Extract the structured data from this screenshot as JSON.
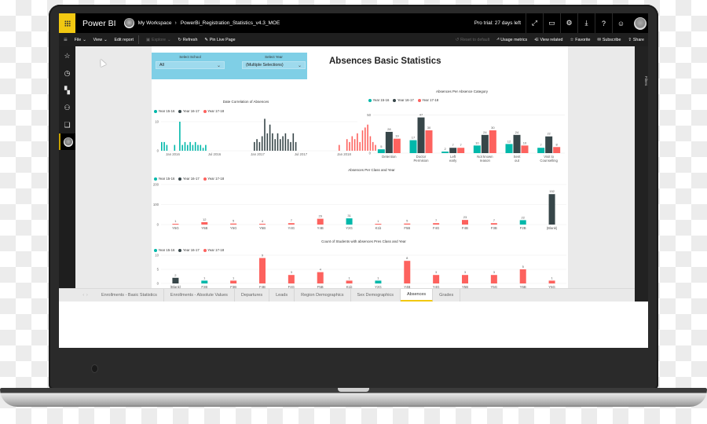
{
  "app": {
    "brand": "Power BI",
    "breadcrumb": [
      "My Workspace",
      "PowerBi_Registration_Statistics_v4.3_MOE"
    ],
    "trial_text": "Pro trial: 27 days left",
    "topbar_icons": [
      "expand-icon",
      "feedback-icon",
      "gear-icon",
      "download-icon",
      "help-icon",
      "smiley-icon"
    ]
  },
  "actionbar": {
    "file": "File",
    "view": "View",
    "edit_report": "Edit report",
    "explore": "Explore",
    "refresh": "Refresh",
    "pin_live_page": "Pin Live Page",
    "reset_to_default": "Reset to default",
    "usage_metrics": "Usage metrics",
    "view_related": "View related",
    "favorite": "Favorite",
    "subscribe": "Subscribe",
    "share": "Share"
  },
  "rightpane": {
    "label": "Filters"
  },
  "slicers": [
    {
      "label": "Select School",
      "value": "All"
    },
    {
      "label": "Select Year",
      "value": "(Multiple Selections)"
    }
  ],
  "report": {
    "title": "Absences Basic Statistics"
  },
  "legend": [
    "Year 15-16",
    "Year 16-17",
    "Year 17-18"
  ],
  "colors": {
    "y1516": "#01b8aa",
    "y1617": "#374649",
    "y1718": "#fd625e",
    "accent": "#f2c811"
  },
  "tabs": [
    {
      "label": "Enrollments - Basic Statistics",
      "active": false
    },
    {
      "label": "Enrollments - Absolute Values",
      "active": false
    },
    {
      "label": "Departures",
      "active": false
    },
    {
      "label": "Leads",
      "active": false
    },
    {
      "label": "Region Demographics",
      "active": false
    },
    {
      "label": "Sex Demographics",
      "active": false
    },
    {
      "label": "Absences",
      "active": true
    },
    {
      "label": "Grades",
      "active": false
    }
  ],
  "chart_data": [
    {
      "id": "date-correlation",
      "type": "bar",
      "title": "Date Correlation of Absences",
      "x_ticks": [
        "Jan 2016",
        "Jul 2016",
        "Jan 2017",
        "Jul 2017",
        "Jan 2018"
      ],
      "ylim": [
        0,
        10
      ],
      "y_ticks": [
        0,
        10
      ],
      "series": [
        {
          "name": "Year 15-16",
          "values": [
            3,
            3,
            2,
            0,
            0,
            2,
            0,
            10,
            2,
            3,
            2,
            3,
            2,
            3,
            2,
            2,
            1,
            2
          ]
        },
        {
          "name": "Year 16-17",
          "values": [
            3,
            4,
            3,
            5,
            11,
            6,
            9,
            6,
            4,
            6,
            4,
            5,
            6,
            4,
            3,
            6,
            3
          ]
        },
        {
          "name": "Year 17-18",
          "values": [
            2,
            0,
            0,
            4,
            3,
            5,
            4,
            6,
            3,
            7,
            8,
            9,
            5,
            3,
            2
          ]
        }
      ]
    },
    {
      "id": "absence-category",
      "type": "bar",
      "title": "Absences Per Absence Category",
      "categories": [
        "Detention",
        "Doctor Permision",
        "Left early",
        "Not known reason",
        "Sent out",
        "Visit to Counselling"
      ],
      "ylim": [
        0,
        60
      ],
      "y_ticks": [
        0,
        50
      ],
      "series": [
        {
          "name": "Year 15-16",
          "values": [
            5,
            17,
            2,
            10,
            12,
            7
          ]
        },
        {
          "name": "Year 16-17",
          "values": [
            28,
            47,
            7,
            24,
            24,
            22
          ]
        },
        {
          "name": "Year 17-18",
          "values": [
            19,
            30,
            7,
            30,
            10,
            8
          ]
        }
      ]
    },
    {
      "id": "per-class",
      "type": "bar",
      "title": "Absences Per Class and Year",
      "categories": [
        "Y6G",
        "Y6B",
        "Y5G",
        "Y5B",
        "Y4G",
        "Y4B",
        "Y2G",
        "K1b",
        "F5B",
        "F4G",
        "F4B",
        "F3B",
        "F2B",
        "(Blank)"
      ],
      "ylim": [
        0,
        200
      ],
      "y_ticks": [
        0,
        100,
        200
      ],
      "series": [
        {
          "name": "Year 15-16",
          "values": [
            null,
            null,
            null,
            null,
            null,
            null,
            31,
            null,
            null,
            null,
            null,
            null,
            22,
            null
          ]
        },
        {
          "name": "Year 16-17",
          "values": [
            null,
            null,
            null,
            null,
            null,
            null,
            null,
            null,
            null,
            null,
            null,
            null,
            null,
            152
          ]
        },
        {
          "name": "Year 17-18",
          "values": [
            1,
            12,
            5,
            4,
            7,
            29,
            null,
            1,
            5,
            7,
            23,
            7,
            null,
            null
          ]
        }
      ]
    },
    {
      "id": "student-count",
      "type": "bar",
      "title": "Count of Students with absences Pres Class and Year",
      "categories": [
        "(Blank)",
        "F2B",
        "F3B",
        "F4B",
        "F4G",
        "F5B",
        "K1b",
        "Y2G",
        "Y4B",
        "Y4G",
        "Y5B",
        "Y5G",
        "Y6B",
        "Y6G"
      ],
      "ylim": [
        0,
        10
      ],
      "y_ticks": [
        0,
        5,
        10
      ],
      "series": [
        {
          "name": "Year 15-16",
          "values": [
            null,
            1,
            null,
            null,
            null,
            null,
            null,
            1,
            null,
            null,
            null,
            null,
            null,
            null
          ]
        },
        {
          "name": "Year 16-17",
          "values": [
            2,
            null,
            null,
            null,
            null,
            null,
            null,
            null,
            null,
            null,
            null,
            null,
            null,
            null
          ]
        },
        {
          "name": "Year 17-18",
          "values": [
            null,
            null,
            1,
            9,
            3,
            4,
            1,
            null,
            8,
            3,
            3,
            3,
            5,
            1
          ]
        }
      ]
    }
  ]
}
